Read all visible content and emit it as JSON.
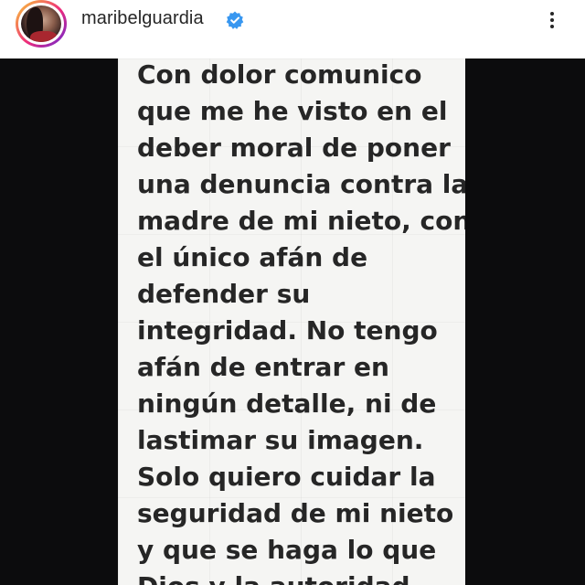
{
  "header": {
    "username": "maribelguardia",
    "verified_icon": "verified-badge-icon",
    "more_icon": "more-options-icon",
    "avatar_icon": "profile-avatar"
  },
  "media": {
    "lines": [
      "Con dolor comunico",
      "que me he visto en el",
      "deber moral de poner",
      "una denuncia contra la",
      "madre de mi nieto, con",
      "el único afán de",
      "defender su",
      "integridad.  No tengo",
      "afán de entrar en",
      "ningún detalle, ni de",
      "lastimar su imagen.",
      "Solo quiero cuidar la",
      "seguridad de mi nieto",
      "y que se haga lo que",
      "Dios y la autoridad"
    ]
  },
  "colors": {
    "verified_badge": "#3897f0",
    "text": "#262626",
    "note_background": "#f5f5f3",
    "letterbox": "#0c0c0d"
  }
}
